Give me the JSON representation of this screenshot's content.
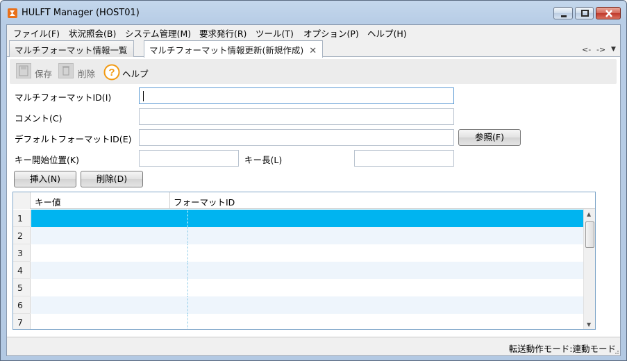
{
  "window": {
    "title": "HULFT Manager (HOST01)"
  },
  "menu": [
    "ファイル(F)",
    "状況照会(B)",
    "システム管理(M)",
    "要求発行(R)",
    "ツール(T)",
    "オプション(P)",
    "ヘルプ(H)"
  ],
  "tabs": [
    {
      "label": "マルチフォーマット情報一覧",
      "active": false
    },
    {
      "label": "マルチフォーマット情報更新(新規作成)",
      "active": true
    }
  ],
  "tab_nav": {
    "back": "<-",
    "forward": "->",
    "menu": "▼"
  },
  "toolbar": {
    "save": "保存",
    "delete": "削除",
    "help": "ヘルプ"
  },
  "form": {
    "multi_format_id_label": "マルチフォーマットID(I)",
    "multi_format_id_value": "",
    "comment_label": "コメント(C)",
    "comment_value": "",
    "default_format_id_label": "デフォルトフォーマットID(E)",
    "default_format_id_value": "",
    "browse_button": "参照(F)",
    "key_start_label": "キー開始位置(K)",
    "key_start_value": "",
    "key_length_label": "キー長(L)",
    "key_length_value": ""
  },
  "actions": {
    "insert": "挿入(N)",
    "delete": "削除(D)"
  },
  "grid": {
    "columns": [
      "キー値",
      "フォーマットID"
    ],
    "rows": [
      {
        "num": "1",
        "key": "",
        "format_id": "",
        "selected": true
      },
      {
        "num": "2",
        "key": "",
        "format_id": ""
      },
      {
        "num": "3",
        "key": "",
        "format_id": ""
      },
      {
        "num": "4",
        "key": "",
        "format_id": ""
      },
      {
        "num": "5",
        "key": "",
        "format_id": ""
      },
      {
        "num": "6",
        "key": "",
        "format_id": ""
      },
      {
        "num": "7",
        "key": "",
        "format_id": ""
      }
    ]
  },
  "status": {
    "text": "転送動作モード:連動モード"
  },
  "colors": {
    "selected_row": "#00b4f0",
    "alt_row": "#eef5fc",
    "focus_border": "#5d9bd4"
  }
}
